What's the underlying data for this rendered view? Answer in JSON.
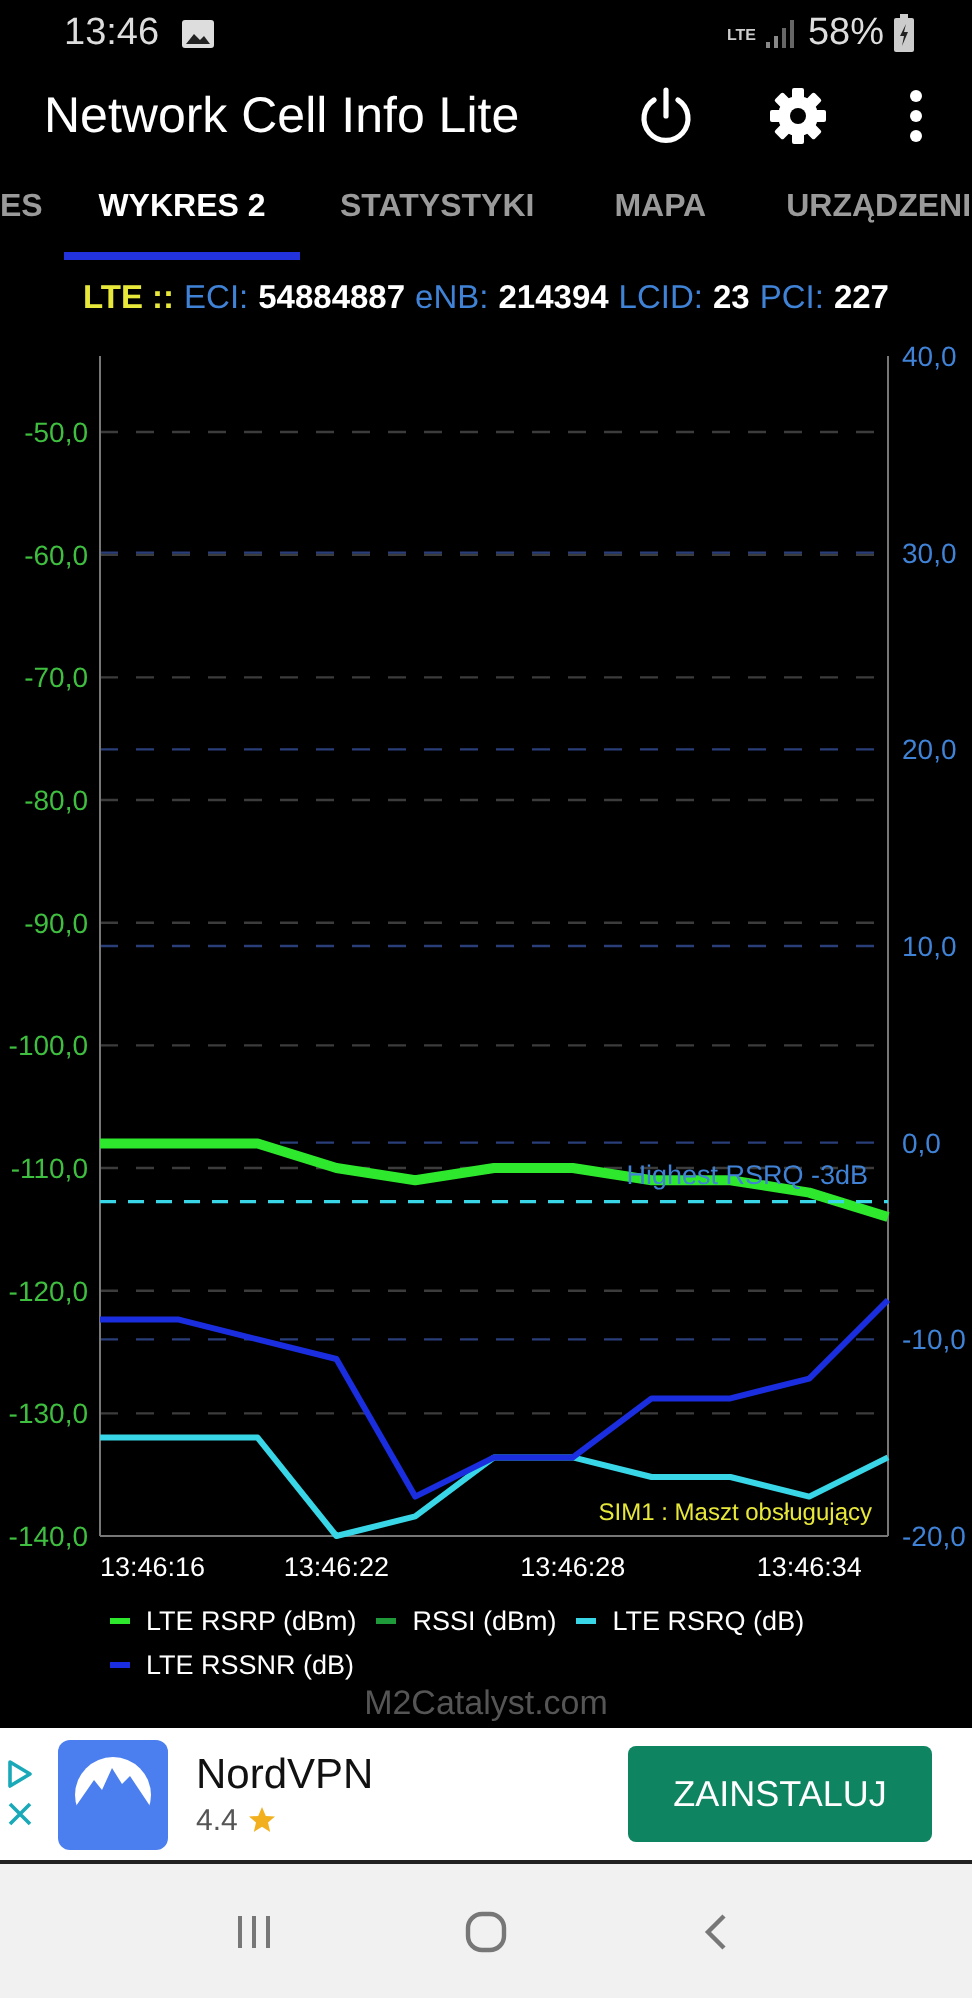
{
  "status_bar": {
    "time": "13:46",
    "network": "LTE",
    "battery": "58%"
  },
  "app_bar": {
    "title": "Network Cell Info Lite"
  },
  "tabs": [
    {
      "label": "ES",
      "selected": false
    },
    {
      "label": "WYKRES 2",
      "selected": true
    },
    {
      "label": "STATYSTYKI",
      "selected": false
    },
    {
      "label": "MAPA",
      "selected": false
    },
    {
      "label": "URZĄDZENI",
      "selected": false
    }
  ],
  "cell_info": {
    "technology": "LTE ::",
    "fields": [
      {
        "label": "ECI:",
        "value": "54884887"
      },
      {
        "label": "eNB:",
        "value": "214394"
      },
      {
        "label": "LCID:",
        "value": "23"
      },
      {
        "label": "PCI:",
        "value": "227"
      }
    ]
  },
  "chart": {
    "chart_data": {
      "type": "line",
      "ylim": [
        -140,
        -43.8
      ],
      "y2lim": [
        -20,
        40
      ],
      "grid": true,
      "xlim": [
        49576,
        49596
      ],
      "x": [
        49576,
        49578,
        49580,
        49582,
        49584,
        49586,
        49588,
        49590,
        49592,
        49594,
        49596
      ],
      "xticks": [
        {
          "value": 49576,
          "label": "13:46:16"
        },
        {
          "value": 49582,
          "label": "13:46:22"
        },
        {
          "value": 49588,
          "label": "13:46:28"
        },
        {
          "value": 49594,
          "label": "13:46:34"
        }
      ],
      "yticks": [
        {
          "value": -50,
          "label": "-50,0"
        },
        {
          "value": -60,
          "label": "-60,0"
        },
        {
          "value": -70,
          "label": "-70,0"
        },
        {
          "value": -80,
          "label": "-80,0"
        },
        {
          "value": -90,
          "label": "-90,0"
        },
        {
          "value": -100,
          "label": "-100,0"
        },
        {
          "value": -110,
          "label": "-110,0"
        },
        {
          "value": -120,
          "label": "-120,0"
        },
        {
          "value": -130,
          "label": "-130,0"
        },
        {
          "value": -140,
          "label": "-140,0"
        }
      ],
      "y2ticks": [
        {
          "value": 40,
          "label": "40,0"
        },
        {
          "value": 30,
          "label": "30,0"
        },
        {
          "value": 20,
          "label": "20,0"
        },
        {
          "value": 10,
          "label": "10,0"
        },
        {
          "value": 0,
          "label": "0,0"
        },
        {
          "value": -10,
          "label": "-10,0"
        },
        {
          "value": -20,
          "label": "-20,0"
        }
      ],
      "series": [
        {
          "name": "LTE RSRP (dBm)",
          "color": "#2ee82e",
          "values": [
            -108,
            -108,
            -108,
            -110,
            -111,
            -110,
            -110,
            -111,
            -111,
            -112,
            -114
          ]
        },
        {
          "name": "RSSI (dBm)",
          "color": "#1f9a3a",
          "values": [
            null,
            null,
            null,
            null,
            null,
            null,
            null,
            null,
            null,
            null,
            null
          ]
        },
        {
          "name": "LTE RSRQ (dB)",
          "color": "#38d6e6",
          "axis": "y2",
          "values": [
            -15,
            -15,
            -15,
            -20,
            -19,
            -16,
            -16,
            -17,
            -17,
            -18,
            -16
          ]
        },
        {
          "name": "LTE RSSNR (dB)",
          "color": "#1a2ee0",
          "axis": "y2",
          "values": [
            -9,
            -9,
            -10,
            -11,
            -18,
            -16,
            -16,
            -13,
            -13,
            -12,
            -8
          ]
        }
      ],
      "ref_lines": [
        {
          "value": -3,
          "axis": "y2",
          "label": "Highest RSRQ -3dB"
        }
      ],
      "annotations": [
        "SIM1 : Maszt obsługujący"
      ]
    },
    "credit": "M2Catalyst.com"
  },
  "ad": {
    "app": "NordVPN",
    "rating": "4.4",
    "button": "ZAINSTALUJ"
  }
}
